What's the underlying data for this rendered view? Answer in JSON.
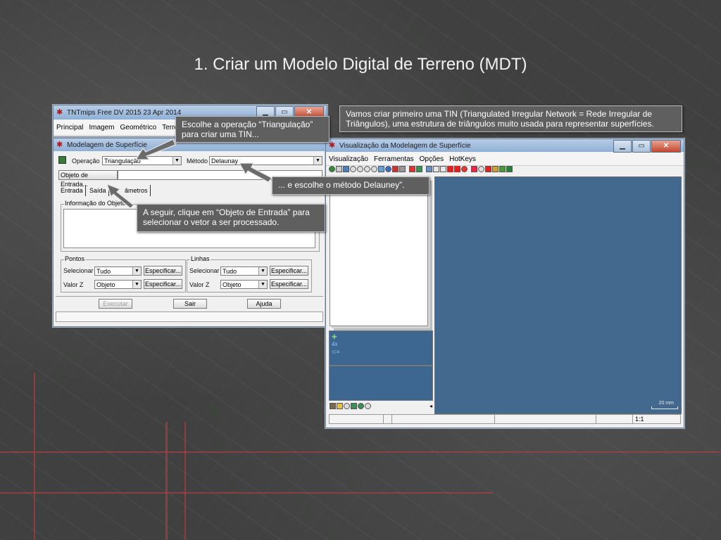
{
  "slide": {
    "title": "1. Criar um Modelo Digital de Terreno (MDT)"
  },
  "tntmips": {
    "title": "TNTmips Free DV 2015   23 Apr 2014",
    "menu": [
      "Principal",
      "Imagem",
      "Geométrico",
      "Terre"
    ],
    "window_buttons": {
      "min": "▁",
      "max": "▭",
      "close": "✕"
    }
  },
  "modelagem": {
    "title": "Modelagem de Superfície",
    "operacao_label": "Operação",
    "operacao_value": "Triangulação",
    "metodo_label": "Método",
    "metodo_value": "Delaunay",
    "objeto_entrada_button": "Objeto de Entrada...",
    "tabs": [
      "Entrada",
      "Saída",
      "Parâmetros"
    ],
    "tab_parametros_visible": "âmetros",
    "info_group": "Informação do Objeto",
    "pontos": {
      "group": "Pontos",
      "selecionar_label": "Selecionar",
      "selecionar_value": "Tudo",
      "especificar": "Especificar...",
      "valorz_label": "Valor Z",
      "valorz_value": "Objeto"
    },
    "linhas": {
      "group": "Linhas",
      "selecionar_label": "Selecionar",
      "selecionar_value": "Tudo",
      "especificar": "Especificar...",
      "valorz_label": "Valor Z",
      "valorz_value": "Objeto"
    },
    "buttons": {
      "executar": "Executar",
      "sair": "Sair",
      "ajuda": "Ajuda"
    }
  },
  "visualizacao": {
    "title": "Visualização da Modelagem de Superfície",
    "menu": [
      "Visualização",
      "Ferramentas",
      "Opções",
      "HotKeys"
    ],
    "scale_label": "20 mm",
    "status_scale": "1:1",
    "colors": {
      "canvas": "#44698e",
      "panel": "#3d6690"
    }
  },
  "callouts": {
    "operacao": "Escolhe a operação “Triangulação” para criar uma TIN...",
    "metodo": "... e escolhe o método Delauney”.",
    "objeto": "A seguir, clique em “Objeto de Entrada” para selecionar o vetor a ser processado.",
    "tin": "Vamos criar primeiro uma TIN (Triangulated Irregular Network = Rede Irregular de Triângulos), uma estrutura de triângulos muito usada para representar superfícies."
  }
}
